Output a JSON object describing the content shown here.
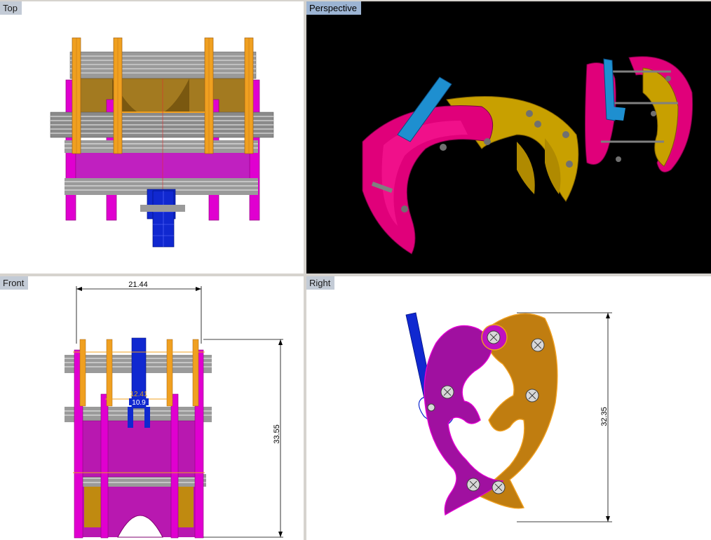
{
  "viewports": {
    "top": {
      "label": "Top"
    },
    "perspective": {
      "label": "Perspective"
    },
    "front": {
      "label": "Front"
    },
    "right": {
      "label": "Right"
    }
  },
  "dimensions": {
    "front_width": "21.44",
    "front_height": "33.55",
    "front_inner_a": "12.41",
    "front_inner_b": "10.9",
    "right_height": "32.35"
  },
  "colors": {
    "magenta": "#e000d0",
    "orange": "#f0a020",
    "gold": "#c89a00",
    "blue": "#1020d0",
    "steel": "#a0a0a0",
    "viewport_label_bg": "#c3cbd6",
    "active_label_bg": "#9cb4d3"
  }
}
